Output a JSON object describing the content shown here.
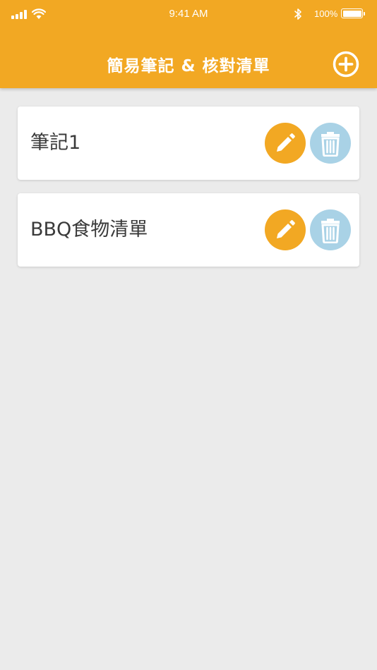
{
  "status_bar": {
    "time": "9:41 AM",
    "battery_percent": "100%",
    "icons": [
      "signal-icon",
      "wifi-icon",
      "bluetooth-icon",
      "battery-icon"
    ]
  },
  "header": {
    "title": "簡易筆記 & 核對清單",
    "add_icon": "plus-circle-icon"
  },
  "notes": [
    {
      "title": "筆記1",
      "edit_icon": "pencil-icon",
      "delete_icon": "trash-icon"
    },
    {
      "title": "BBQ食物清單",
      "edit_icon": "pencil-icon",
      "delete_icon": "trash-icon"
    }
  ],
  "colors": {
    "accent": "#f2a823",
    "delete": "#a9d2e6",
    "background": "#ebebeb",
    "card": "#ffffff",
    "text": "#3a3a3a"
  }
}
